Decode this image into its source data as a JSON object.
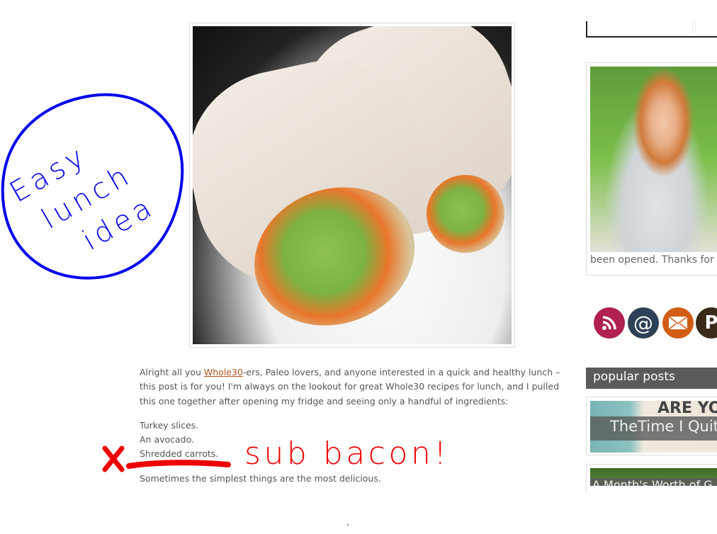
{
  "post": {
    "paragraph1_pre": "Alright all you ",
    "link": "Whole30",
    "paragraph1_post": "-ers, Paleo lovers, and anyone interested in a quick and healthy lunch – this post is for you!  I'm always on the lookout for great Whole30 recipes for lunch, and I pulled this one together after opening my fridge and seeing only a handful of ingredients:",
    "ingredients": [
      "Turkey slices.",
      "An avocado.",
      "Shredded carrots."
    ],
    "closing": "Sometimes the simplest things are the most delicious.",
    "stray_mark": ","
  },
  "sidebar": {
    "profile_caption": "been opened. Thanks for",
    "social": [
      {
        "icon": "rss-icon",
        "color": "#b0214f"
      },
      {
        "icon": "at-icon",
        "color": "#2f4156"
      },
      {
        "icon": "email-icon",
        "color": "#d15d14"
      },
      {
        "icon": "pinterest-icon",
        "color": "#3a2a1a"
      }
    ],
    "popular_header": "popular posts",
    "popular_posts": [
      {
        "title": "TheTime I Quit",
        "image_text": "ARE YOU HAPPY"
      },
      {
        "title": "A Month's Worth of G"
      }
    ]
  },
  "annotations": {
    "blue_note": "Easy lunch idea",
    "red_note": "sub bacon!",
    "blue_color": "#0000ee",
    "red_color": "#ee0000"
  }
}
